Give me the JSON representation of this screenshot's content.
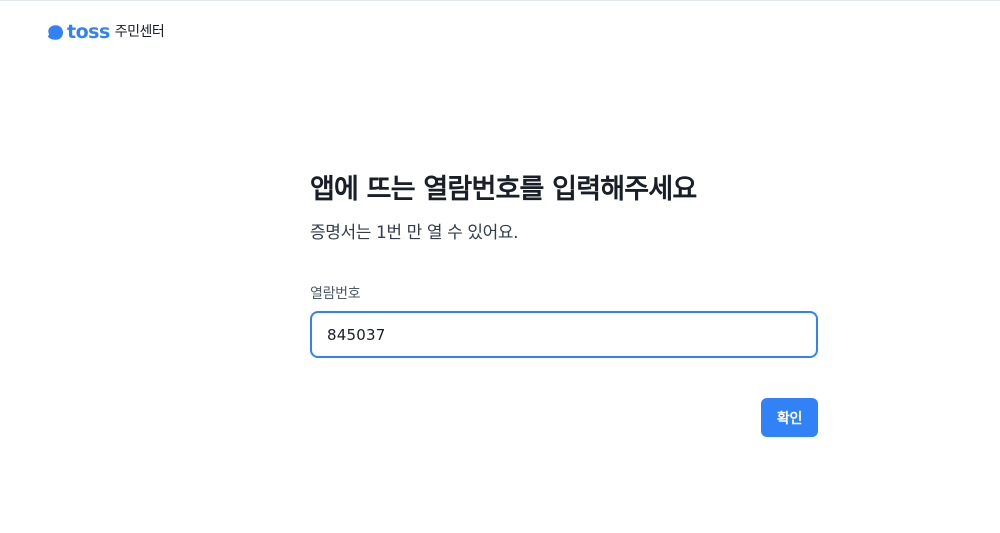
{
  "header": {
    "logo_icon": "toss-logo-icon",
    "logo_text": "toss",
    "service_name": "주민센터"
  },
  "main": {
    "title": "앱에 뜨는 열람번호를 입력해주세요",
    "subtitle": "증명서는 1번 만 열 수 있어요.",
    "field_label": "열람번호",
    "field_value": "845037"
  },
  "actions": {
    "confirm_label": "확인"
  },
  "colors": {
    "accent": "#3182f6",
    "text_primary": "#191f28",
    "text_secondary": "#4e5968"
  }
}
